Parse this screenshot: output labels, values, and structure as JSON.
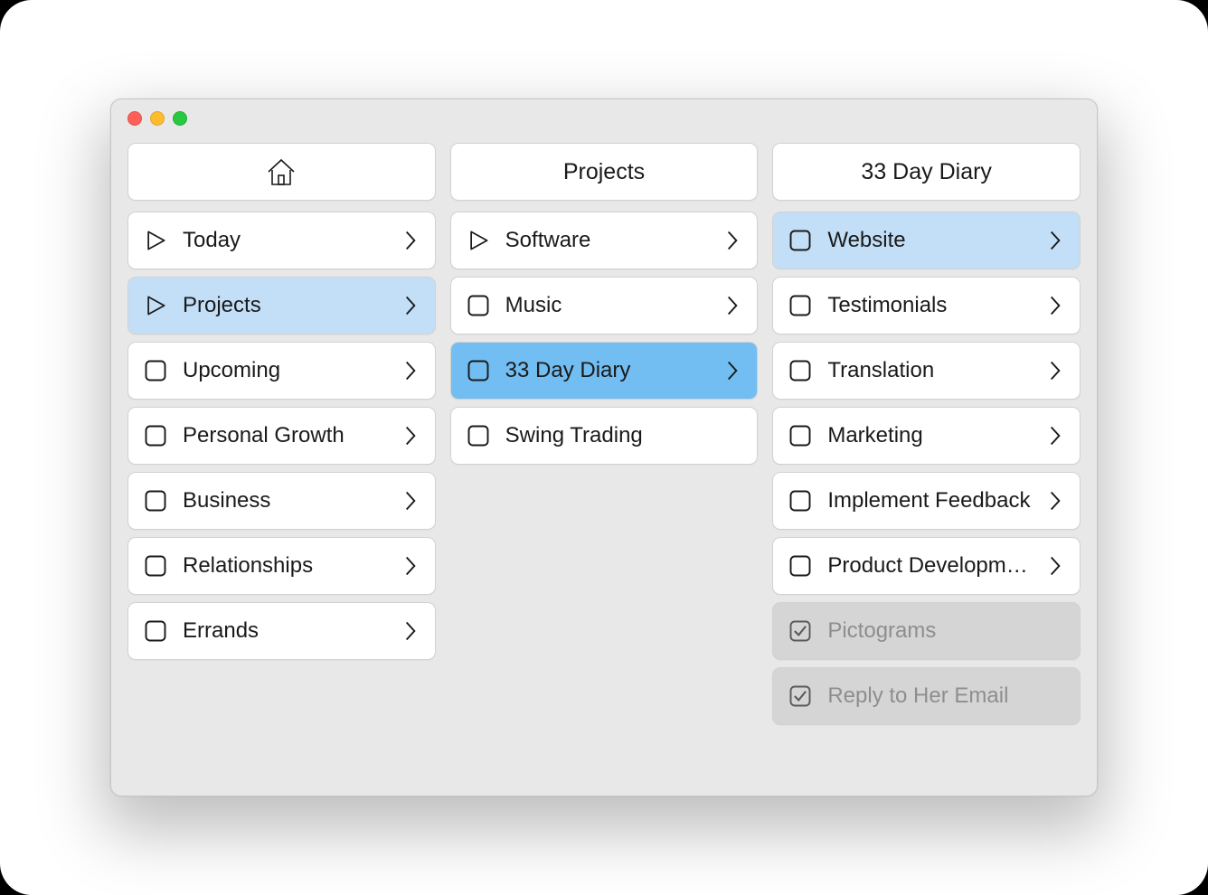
{
  "traffic_lights": {
    "close": "#ff5f57",
    "minimize": "#febc2e",
    "zoom": "#28c840"
  },
  "columns": [
    {
      "id": "home",
      "header_icon": "home-icon",
      "header_label": "",
      "items": [
        {
          "icon": "play",
          "label": "Today",
          "has_children": true,
          "state": "normal"
        },
        {
          "icon": "play",
          "label": "Projects",
          "has_children": true,
          "state": "selected-light"
        },
        {
          "icon": "box",
          "label": "Upcoming",
          "has_children": true,
          "state": "normal"
        },
        {
          "icon": "box",
          "label": "Personal Growth",
          "has_children": true,
          "state": "normal"
        },
        {
          "icon": "box",
          "label": "Business",
          "has_children": true,
          "state": "normal"
        },
        {
          "icon": "box",
          "label": "Relationships",
          "has_children": true,
          "state": "normal"
        },
        {
          "icon": "box",
          "label": "Errands",
          "has_children": true,
          "state": "normal"
        }
      ]
    },
    {
      "id": "projects",
      "header_icon": null,
      "header_label": "Projects",
      "items": [
        {
          "icon": "play",
          "label": "Software",
          "has_children": true,
          "state": "normal"
        },
        {
          "icon": "box",
          "label": "Music",
          "has_children": true,
          "state": "normal"
        },
        {
          "icon": "box",
          "label": "33 Day Diary",
          "has_children": true,
          "state": "selected-mid"
        },
        {
          "icon": "box",
          "label": "Swing Trading",
          "has_children": false,
          "state": "normal"
        }
      ]
    },
    {
      "id": "33-day-diary",
      "header_icon": null,
      "header_label": "33 Day Diary",
      "items": [
        {
          "icon": "box",
          "label": "Website",
          "has_children": true,
          "state": "selected-light"
        },
        {
          "icon": "box",
          "label": "Testimonials",
          "has_children": true,
          "state": "normal"
        },
        {
          "icon": "box",
          "label": "Translation",
          "has_children": true,
          "state": "normal"
        },
        {
          "icon": "box",
          "label": "Marketing",
          "has_children": true,
          "state": "normal"
        },
        {
          "icon": "box",
          "label": "Implement Feedback",
          "has_children": true,
          "state": "normal"
        },
        {
          "icon": "box",
          "label": "Product Development",
          "has_children": true,
          "state": "normal"
        },
        {
          "icon": "check",
          "label": "Pictograms",
          "has_children": false,
          "state": "done"
        },
        {
          "icon": "check",
          "label": "Reply to Her Email",
          "has_children": false,
          "state": "done"
        }
      ]
    }
  ]
}
